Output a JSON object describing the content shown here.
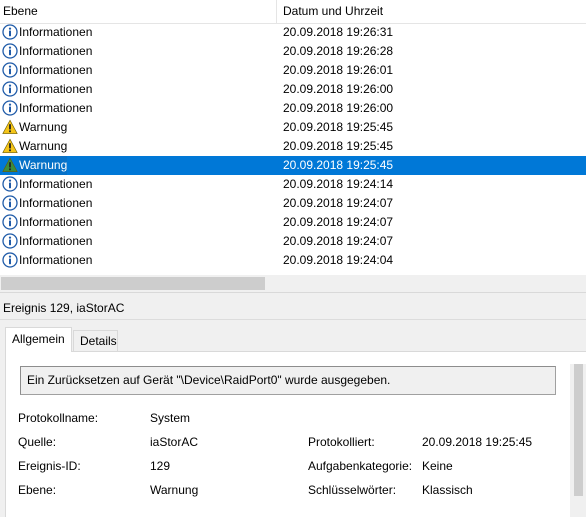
{
  "list": {
    "columns": {
      "level": "Ebene",
      "datetime": "Datum und Uhrzeit"
    },
    "rows": [
      {
        "level": "Informationen",
        "icon": "info-icon",
        "datetime": "20.09.2018 19:26:31",
        "selected": false
      },
      {
        "level": "Informationen",
        "icon": "info-icon",
        "datetime": "20.09.2018 19:26:28",
        "selected": false
      },
      {
        "level": "Informationen",
        "icon": "info-icon",
        "datetime": "20.09.2018 19:26:01",
        "selected": false
      },
      {
        "level": "Informationen",
        "icon": "info-icon",
        "datetime": "20.09.2018 19:26:00",
        "selected": false
      },
      {
        "level": "Informationen",
        "icon": "info-icon",
        "datetime": "20.09.2018 19:26:00",
        "selected": false
      },
      {
        "level": "Warnung",
        "icon": "warning-icon",
        "datetime": "20.09.2018 19:25:45",
        "selected": false
      },
      {
        "level": "Warnung",
        "icon": "warning-icon",
        "datetime": "20.09.2018 19:25:45",
        "selected": false
      },
      {
        "level": "Warnung",
        "icon": "warning-icon",
        "datetime": "20.09.2018 19:25:45",
        "selected": true
      },
      {
        "level": "Informationen",
        "icon": "info-icon",
        "datetime": "20.09.2018 19:24:14",
        "selected": false
      },
      {
        "level": "Informationen",
        "icon": "info-icon",
        "datetime": "20.09.2018 19:24:07",
        "selected": false
      },
      {
        "level": "Informationen",
        "icon": "info-icon",
        "datetime": "20.09.2018 19:24:07",
        "selected": false
      },
      {
        "level": "Informationen",
        "icon": "info-icon",
        "datetime": "20.09.2018 19:24:07",
        "selected": false
      },
      {
        "level": "Informationen",
        "icon": "info-icon",
        "datetime": "20.09.2018 19:24:04",
        "selected": false
      }
    ]
  },
  "detail": {
    "title": "Ereignis 129, iaStorAC",
    "tabs": {
      "general": "Allgemein",
      "details": "Details"
    },
    "message": "Ein Zurücksetzen auf Gerät \"\\Device\\RaidPort0\" wurde ausgegeben.",
    "fields": {
      "log_name_label": "Protokollname:",
      "log_name_value": "System",
      "source_label": "Quelle:",
      "source_value": "iaStorAC",
      "logged_label": "Protokolliert:",
      "logged_value": "20.09.2018 19:25:45",
      "event_id_label": "Ereignis-ID:",
      "event_id_value": "129",
      "task_category_label": "Aufgabenkategorie:",
      "task_category_value": "Keine",
      "level_label": "Ebene:",
      "level_value": "Warnung",
      "keywords_label": "Schlüsselwörter:",
      "keywords_value": "Klassisch"
    }
  },
  "colors": {
    "selection": "#0078d7",
    "info_icon": "#1e5aa8",
    "warning_icon": "#f5c518",
    "warning_icon_selected": "#3c8d3c"
  }
}
